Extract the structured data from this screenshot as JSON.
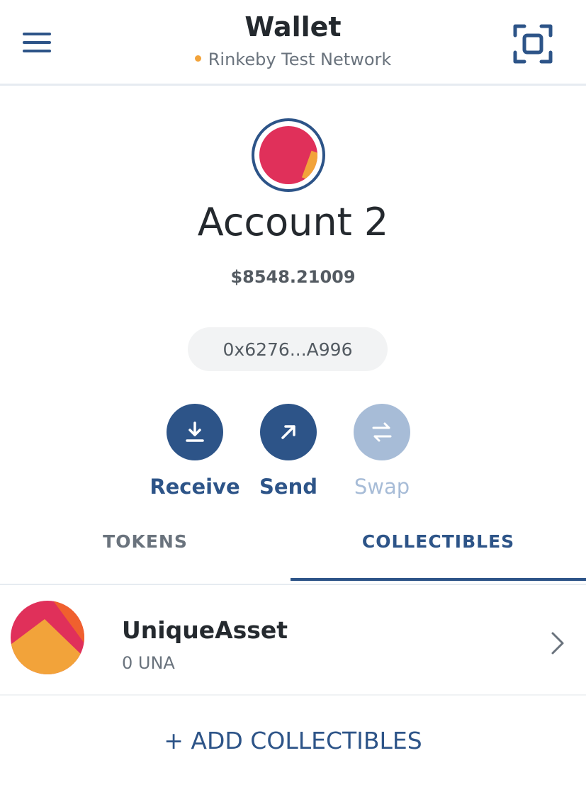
{
  "header": {
    "title": "Wallet",
    "network": "Rinkeby Test Network",
    "network_status_color": "#f2a33a",
    "menu_icon": "hamburger-menu-icon",
    "scan_icon": "qr-scan-icon"
  },
  "account": {
    "name": "Account 2",
    "balance": "$8548.21009",
    "address": "0x6276...A996"
  },
  "actions": [
    {
      "label": "Receive",
      "icon": "receive-download-icon",
      "enabled": true
    },
    {
      "label": "Send",
      "icon": "send-arrow-icon",
      "enabled": true
    },
    {
      "label": "Swap",
      "icon": "swap-icon",
      "enabled": false
    }
  ],
  "tabs": [
    {
      "label": "TOKENS",
      "active": false
    },
    {
      "label": "COLLECTIBLES",
      "active": true
    }
  ],
  "collectibles": [
    {
      "name": "UniqueAsset",
      "balance": "0 UNA"
    }
  ],
  "add_collectibles_label": "+ ADD COLLECTIBLES",
  "colors": {
    "accent": "#2d5488",
    "disabled": "#a7bcd7",
    "avatar": "#e0305a",
    "asset_orange": "#f2a33a"
  }
}
